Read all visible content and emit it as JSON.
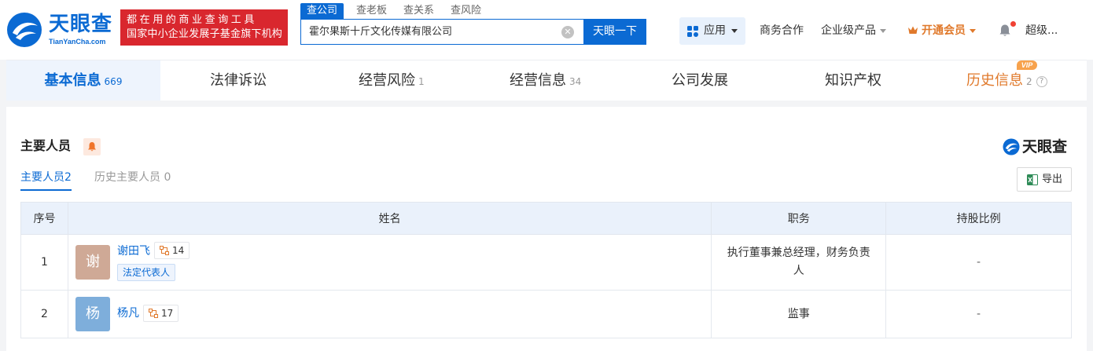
{
  "brand": {
    "name_cn": "天眼查",
    "name_en": "TianYanCha.com",
    "slogan_line1": "都在用的商业查询工具",
    "slogan_line2": "国家中小企业发展子基金旗下机构",
    "color": "#0b6ad3"
  },
  "search": {
    "tabs": [
      "查公司",
      "查老板",
      "查关系",
      "查风险"
    ],
    "active_tab": "查公司",
    "value": "霍尔果斯十斤文化传媒有限公司",
    "button": "天眼一下"
  },
  "topnav": {
    "app": "应用",
    "business": "商务合作",
    "enterprise": "企业级产品",
    "vip": "开通会员",
    "user": "超级..."
  },
  "tabs": [
    {
      "label": "基本信息",
      "count": "669"
    },
    {
      "label": "法律诉讼",
      "count": ""
    },
    {
      "label": "经营风险",
      "count": "1"
    },
    {
      "label": "经营信息",
      "count": "34"
    },
    {
      "label": "公司发展",
      "count": ""
    },
    {
      "label": "知识产权",
      "count": ""
    },
    {
      "label": "历史信息",
      "count": "2",
      "badge": "VIP"
    }
  ],
  "section": {
    "title": "主要人员",
    "brand_mark": "天眼查",
    "subtabs": [
      {
        "label": "主要人员",
        "count": "2"
      },
      {
        "label": "历史主要人员",
        "count": "0"
      }
    ],
    "export": "导出",
    "table": {
      "headers": [
        "序号",
        "姓名",
        "职务",
        "持股比例"
      ],
      "rows": [
        {
          "index": "1",
          "avatar": "谢",
          "avatar_color": "#cfa996",
          "name": "谢田飞",
          "relations": "14",
          "tag": "法定代表人",
          "position_line1": "执行董事兼总经理，财务负责",
          "position_line2": "人",
          "share": "-"
        },
        {
          "index": "2",
          "avatar": "杨",
          "avatar_color": "#7eaedb",
          "name": "杨凡",
          "relations": "17",
          "tag": "",
          "position_line1": "监事",
          "position_line2": "",
          "share": "-"
        }
      ]
    }
  }
}
